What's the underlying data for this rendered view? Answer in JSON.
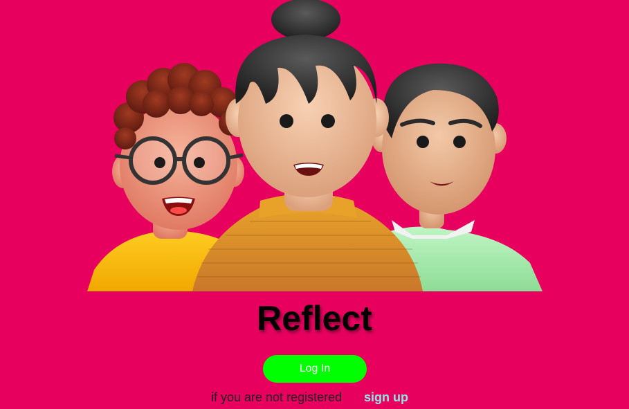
{
  "app": {
    "title": "Reflect"
  },
  "hero": {
    "image_name": "three-3d-avatars-illustration"
  },
  "auth": {
    "login_label": "Log In",
    "register_prompt": "if you are not registered",
    "signup_label": "sign up"
  },
  "colors": {
    "background": "#e8005f",
    "login_button": "#00ff00",
    "signup_link": "#8fe6e6",
    "title": "#000000"
  }
}
